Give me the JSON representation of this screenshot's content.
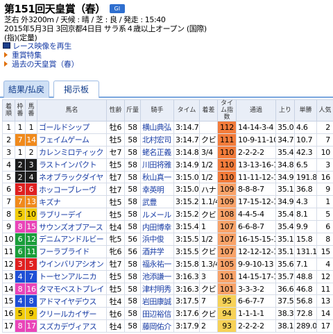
{
  "race": {
    "title": "第151回天皇賞（春）",
    "grade": "GⅠ",
    "line1": "芝右 外3200m / 天候 : 晴 / 芝 : 良 / 発走 : 15:40",
    "line2": "2015年5月3日  3回京都4日目  サラ系４歳以上オープン (国際)",
    "line3": "(指)(定量)"
  },
  "links": [
    {
      "label": "レース映像を再生",
      "icon": "tv-icon"
    },
    {
      "label": "重賞特集",
      "icon": "arrow-icon"
    },
    {
      "label": "過去の天皇賞（春）",
      "icon": "arrow-icon"
    }
  ],
  "tabs": [
    {
      "label": "結果/払戻",
      "active": true
    },
    {
      "label": "掲示板",
      "active": false
    }
  ],
  "columns": [
    "着順",
    "枠番",
    "馬番",
    "馬名",
    "性齢",
    "斤量",
    "騎手",
    "タイム",
    "着差",
    "タイム指数",
    "通過",
    "上り",
    "単勝",
    "人気"
  ],
  "rows": [
    {
      "rank": "1",
      "waku": "1",
      "uma": "1",
      "horse": "ゴールドシップ",
      "sexage": "牡6",
      "weight": "58",
      "jockey": "横山典弘",
      "time": "3:14.7",
      "margin": "",
      "index": "112",
      "passing": "14-14-3-4",
      "last": "35.0",
      "odds": "4.6",
      "pop": "2"
    },
    {
      "rank": "2",
      "waku": "7",
      "uma": "14",
      "horse": "フェイムゲーム",
      "sexage": "牡5",
      "weight": "58",
      "jockey": "北村宏司",
      "time": "3:14.7",
      "margin": "クビ",
      "index": "111",
      "passing": "10-9-11-10",
      "last": "34.7",
      "odds": "10.7",
      "pop": "7"
    },
    {
      "rank": "3",
      "waku": "1",
      "uma": "2",
      "horse": "カレンミロティック",
      "sexage": "セ7",
      "weight": "58",
      "jockey": "蛯名正義",
      "time": "3:14.8",
      "margin": "3/4",
      "index": "110",
      "passing": "2-2-2-2",
      "last": "35.4",
      "odds": "42.3",
      "pop": "10"
    },
    {
      "rank": "4",
      "waku": "2",
      "uma": "3",
      "horse": "ラストインパクト",
      "sexage": "牡5",
      "weight": "58",
      "jockey": "川田将雅",
      "time": "3:14.9",
      "margin": "1/2",
      "index": "110",
      "passing": "13-13-16-14",
      "last": "34.8",
      "odds": "6.5",
      "pop": "3"
    },
    {
      "rank": "5",
      "waku": "2",
      "uma": "4",
      "horse": "ネオブラックダイヤ",
      "sexage": "牡7",
      "weight": "58",
      "jockey": "秋山真一",
      "time": "3:15.0",
      "margin": "1/2",
      "index": "110",
      "passing": "11-11-12-10",
      "last": "34.9",
      "odds": "191.8",
      "pop": "16"
    },
    {
      "rank": "6",
      "waku": "3",
      "uma": "6",
      "horse": "ホッコーブレーヴ",
      "sexage": "牡7",
      "weight": "58",
      "jockey": "幸英明",
      "time": "3:15.0",
      "margin": "ハナ",
      "index": "109",
      "passing": "8-8-8-7",
      "last": "35.1",
      "odds": "36.8",
      "pop": "9"
    },
    {
      "rank": "7",
      "waku": "7",
      "uma": "13",
      "horse": "キズナ",
      "sexage": "牡5",
      "weight": "58",
      "jockey": "武豊",
      "time": "3:15.2",
      "margin": "1.1/4",
      "index": "109",
      "passing": "17-15-12-10",
      "last": "34.9",
      "odds": "4.3",
      "pop": "1"
    },
    {
      "rank": "8",
      "waku": "5",
      "uma": "10",
      "horse": "ラブリーデイ",
      "sexage": "牡5",
      "weight": "58",
      "jockey": "ルメール",
      "time": "3:15.2",
      "margin": "クビ",
      "index": "108",
      "passing": "4-4-5-4",
      "last": "35.4",
      "odds": "8.1",
      "pop": "5"
    },
    {
      "rank": "9",
      "waku": "8",
      "uma": "15",
      "horse": "サウンズオブアース",
      "sexage": "牡4",
      "weight": "58",
      "jockey": "内田博幸",
      "time": "3:15.4",
      "margin": "1",
      "index": "107",
      "passing": "6-6-8-7",
      "last": "35.4",
      "odds": "9.9",
      "pop": "6"
    },
    {
      "rank": "10",
      "waku": "6",
      "uma": "12",
      "horse": "デニムアンドルビー",
      "sexage": "牝5",
      "weight": "56",
      "jockey": "浜中俊",
      "time": "3:15.5",
      "margin": "1/2",
      "index": "107",
      "passing": "16-15-15-16",
      "last": "35.1",
      "odds": "15.8",
      "pop": "8"
    },
    {
      "rank": "11",
      "waku": "6",
      "uma": "11",
      "horse": "フーラブライド",
      "sexage": "牝6",
      "weight": "56",
      "jockey": "酒井学",
      "time": "3:15.5",
      "margin": "クビ",
      "index": "107",
      "passing": "12-12-12-14",
      "last": "35.1",
      "odds": "131.1",
      "pop": "15"
    },
    {
      "rank": "12",
      "waku": "3",
      "uma": "5",
      "horse": "ウインバリアシオン",
      "sexage": "牡7",
      "weight": "58",
      "jockey": "福永祐一",
      "time": "3:15.8",
      "margin": "1.3/4",
      "index": "105",
      "passing": "9-9-10-13",
      "last": "35.6",
      "odds": "7.1",
      "pop": "4"
    },
    {
      "rank": "13",
      "waku": "4",
      "uma": "7",
      "horse": "トーセンアルニカ",
      "sexage": "牡5",
      "weight": "58",
      "jockey": "池添謙一",
      "time": "3:16.3",
      "margin": "3",
      "index": "101",
      "passing": "14-15-17-17",
      "last": "35.7",
      "odds": "48.8",
      "pop": "12"
    },
    {
      "rank": "14",
      "waku": "8",
      "uma": "16",
      "horse": "タマモベストプレイ",
      "sexage": "牡5",
      "weight": "58",
      "jockey": "津村明秀",
      "time": "3:16.3",
      "margin": "クビ",
      "index": "101",
      "passing": "3-3-3-2",
      "last": "36.6",
      "odds": "46.8",
      "pop": "11"
    },
    {
      "rank": "15",
      "waku": "4",
      "uma": "8",
      "horse": "アドマイヤデウス",
      "sexage": "牡4",
      "weight": "58",
      "jockey": "岩田康誠",
      "time": "3:17.5",
      "margin": "7",
      "index": "95",
      "passing": "6-6-7-7",
      "last": "37.5",
      "odds": "56.8",
      "pop": "13"
    },
    {
      "rank": "16",
      "waku": "5",
      "uma": "9",
      "horse": "クリールカイザー",
      "sexage": "牡6",
      "weight": "58",
      "jockey": "田辺裕信",
      "time": "3:17.6",
      "margin": "クビ",
      "index": "94",
      "passing": "1-1-1-1",
      "last": "38.3",
      "odds": "72.8",
      "pop": "14"
    },
    {
      "rank": "17",
      "waku": "8",
      "uma": "17",
      "horse": "スズカデヴィアス",
      "sexage": "牡4",
      "weight": "58",
      "jockey": "藤岡佑介",
      "time": "3:17.9",
      "margin": "2",
      "index": "93",
      "passing": "2-2-2-2",
      "last": "38.1",
      "odds": "289.0",
      "pop": "17"
    }
  ]
}
